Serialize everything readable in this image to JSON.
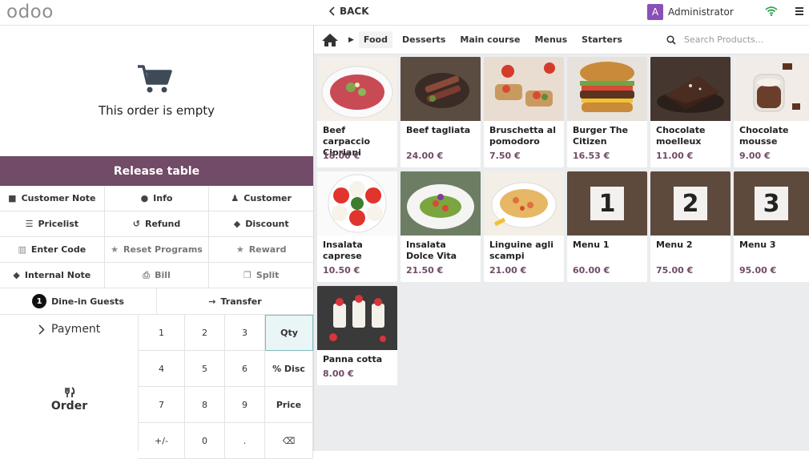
{
  "header": {
    "logo": "odoo",
    "back_label": "BACK",
    "user_initial": "A",
    "user_name": "Administrator",
    "colors": {
      "avatar": "#8b4fb9",
      "wifi": "#27a94b"
    }
  },
  "order": {
    "empty_text": "This order is empty",
    "release_label": "Release table",
    "buttons": [
      {
        "label": "Customer Note",
        "icon": "note-icon"
      },
      {
        "label": "Info",
        "icon": "info-icon"
      },
      {
        "label": "Customer",
        "icon": "user-icon"
      },
      {
        "label": "Pricelist",
        "icon": "list-icon"
      },
      {
        "label": "Refund",
        "icon": "undo-icon"
      },
      {
        "label": "Discount",
        "icon": "tag-icon"
      },
      {
        "label": "Enter Code",
        "icon": "barcode-icon"
      },
      {
        "label": "Reset Programs",
        "icon": "star-icon"
      },
      {
        "label": "Reward",
        "icon": "star-icon"
      },
      {
        "label": "Internal Note",
        "icon": "tag-icon"
      },
      {
        "label": "Bill",
        "icon": "print-icon"
      },
      {
        "label": "Split",
        "icon": "copy-icon"
      }
    ],
    "guests_count": "1",
    "guests_label": "Dine-in Guests",
    "transfer_label": "Transfer",
    "payment_label": "Payment",
    "order_label": "Order",
    "numpad": [
      "1",
      "2",
      "3",
      "Qty",
      "4",
      "5",
      "6",
      "% Disc",
      "7",
      "8",
      "9",
      "Price",
      "+/-",
      "0",
      ".",
      "⌫"
    ],
    "active_mode": "Qty",
    "accent_color": "#714b67"
  },
  "catalog": {
    "categories": [
      "Food",
      "Desserts",
      "Main course",
      "Menus",
      "Starters"
    ],
    "active_category": "Food",
    "search_placeholder": "Search Products...",
    "products": [
      {
        "name": "Beef carpaccio Cipriani",
        "price": "18.00 €"
      },
      {
        "name": "Beef tagliata",
        "price": "24.00 €"
      },
      {
        "name": "Bruschetta al pomodoro",
        "price": "7.50 €"
      },
      {
        "name": "Burger The Citizen",
        "price": "16.53 €"
      },
      {
        "name": "Chocolate moelleux",
        "price": "11.00 €"
      },
      {
        "name": "Chocolate mousse",
        "price": "9.00 €"
      },
      {
        "name": "Insalata caprese",
        "price": "10.50 €"
      },
      {
        "name": "Insalata Dolce Vita",
        "price": "21.50 €"
      },
      {
        "name": "Linguine agli scampi",
        "price": "21.00 €"
      },
      {
        "name": "Menu 1",
        "price": "60.00 €",
        "badge": "1"
      },
      {
        "name": "Menu 2",
        "price": "75.00 €",
        "badge": "2"
      },
      {
        "name": "Menu 3",
        "price": "95.00 €",
        "badge": "3"
      },
      {
        "name": "Panna cotta",
        "price": "8.00 €"
      }
    ]
  }
}
